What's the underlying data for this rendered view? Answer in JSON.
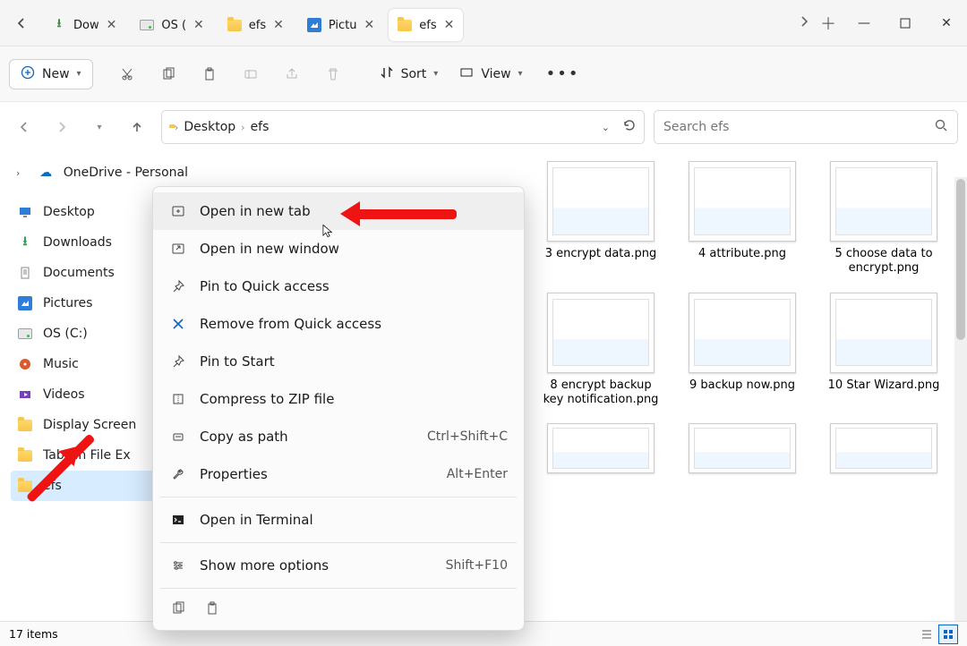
{
  "tabs": [
    {
      "label": "Dow",
      "iconType": "download"
    },
    {
      "label": "OS (",
      "iconType": "drive"
    },
    {
      "label": "efs",
      "iconType": "folder"
    },
    {
      "label": "Pictu",
      "iconType": "image"
    },
    {
      "label": "efs",
      "iconType": "folder",
      "active": true
    }
  ],
  "toolbar": {
    "new_label": "New",
    "sort_label": "Sort",
    "view_label": "View"
  },
  "breadcrumb": {
    "segments": [
      "Desktop",
      "efs"
    ]
  },
  "search": {
    "placeholder": "Search efs"
  },
  "sidebar": {
    "onedrive": "OneDrive - Personal",
    "items": [
      {
        "label": "Desktop",
        "icon": "desktop"
      },
      {
        "label": "Downloads",
        "icon": "download"
      },
      {
        "label": "Documents",
        "icon": "document"
      },
      {
        "label": "Pictures",
        "icon": "image"
      },
      {
        "label": "OS (C:)",
        "icon": "drive"
      },
      {
        "label": "Music",
        "icon": "music"
      },
      {
        "label": "Videos",
        "icon": "video"
      },
      {
        "label": "Display Screen",
        "icon": "folder"
      },
      {
        "label": "Tabs in File Ex",
        "icon": "folder"
      },
      {
        "label": "efs",
        "icon": "folder",
        "selected": true
      }
    ]
  },
  "context_menu": {
    "open_new_tab": "Open in new tab",
    "open_new_window": "Open in new window",
    "pin_quick": "Pin to Quick access",
    "remove_quick": "Remove from Quick access",
    "pin_start": "Pin to Start",
    "compress_zip": "Compress to ZIP file",
    "copy_path": "Copy as path",
    "copy_path_sc": "Ctrl+Shift+C",
    "properties": "Properties",
    "properties_sc": "Alt+Enter",
    "open_terminal": "Open in Terminal",
    "show_more": "Show more options",
    "show_more_sc": "Shift+F10"
  },
  "files": [
    {
      "name": "3 encrypt data.png"
    },
    {
      "name": "4 attribute.png"
    },
    {
      "name": "5 choose data to encrypt.png"
    },
    {
      "name": "8 encrypt backup key notification.png"
    },
    {
      "name": "9 backup now.png"
    },
    {
      "name": "10 Star Wizard.png"
    }
  ],
  "status": {
    "count": "17 items"
  }
}
